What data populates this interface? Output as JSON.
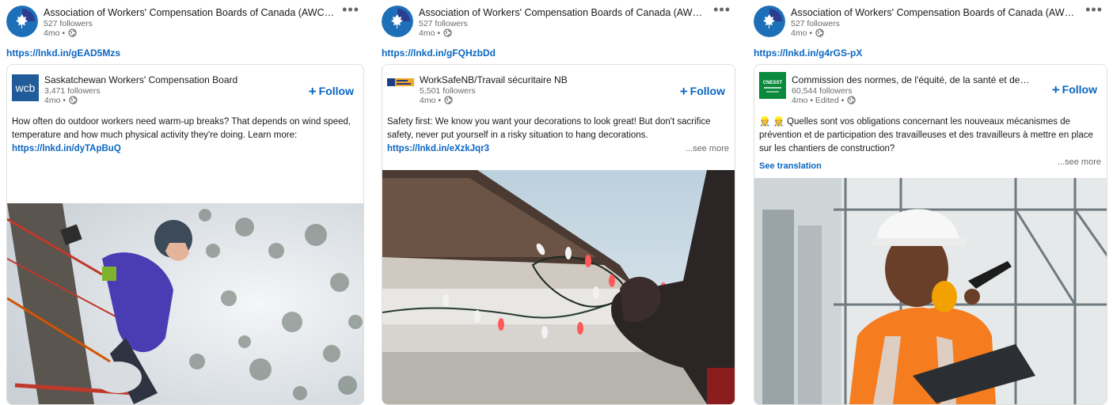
{
  "posts": [
    {
      "author": "Association of Workers' Compensation Boards of Canada (AWCBC/A...",
      "followers": "527 followers",
      "time": "4mo •",
      "more": "•••",
      "link": "https://lnkd.in/gEAD5Mzs",
      "shared": {
        "name": "Saskatchewan Workers' Compensation Board",
        "followers": "3,471 followers",
        "time": "4mo •",
        "follow_label": "Follow",
        "logo_text": "wcb",
        "body": "How often do outdoor workers need warm-up breaks? That depends on wind speed, temperature and how much physical activity they're doing. Learn more:",
        "body_link": "https://lnkd.in/dyTApBuQ"
      }
    },
    {
      "author": "Association of Workers' Compensation Boards of Canada (AWCBC/A...",
      "followers": "527 followers",
      "time": "4mo •",
      "more": "•••",
      "link": "https://lnkd.in/gFQHzbDd",
      "shared": {
        "name": "WorkSafeNB/Travail sécuritaire NB",
        "followers": "5,501 followers",
        "time": "4mo •",
        "follow_label": "Follow",
        "body": "Safety first: We know you want your decorations to look great! But don't sacrifice safety, never put yourself in a risky situation to hang decorations.",
        "body_link": "https://lnkd.in/eXzkJqr3",
        "see_more": "...see more"
      }
    },
    {
      "author": "Association of Workers' Compensation Boards of Canada (AWCBC/A...",
      "followers": "527 followers",
      "time": "4mo •",
      "more": "•••",
      "link": "https://lnkd.in/g4rGS-pX",
      "shared": {
        "name": "Commission des normes, de l'équité, de la santé et de la s...",
        "followers": "60,544 followers",
        "time": "4mo • Edited •",
        "follow_label": "Follow",
        "logo_text": "CNESST",
        "body": "Quelles sont vos obligations concernant les nouveaux mécanismes de prévention et de participation des travailleuses et des travailleurs à mettre en place sur les chantiers de construction?",
        "body_emoji": "👷 👷",
        "see_more": "...see more",
        "see_translation": "See translation"
      }
    }
  ],
  "colors": {
    "link": "#0a66c2",
    "awcbc_blue": "#1d70b8",
    "wcb_blue": "#1f5c99",
    "cnesst_green": "#0a8a3c"
  },
  "icons": [
    "awcbc-logo-icon",
    "globe-icon",
    "more-icon",
    "plus-icon",
    "wcb-logo-icon",
    "worksafenb-logo-icon",
    "cnesst-logo-icon"
  ]
}
